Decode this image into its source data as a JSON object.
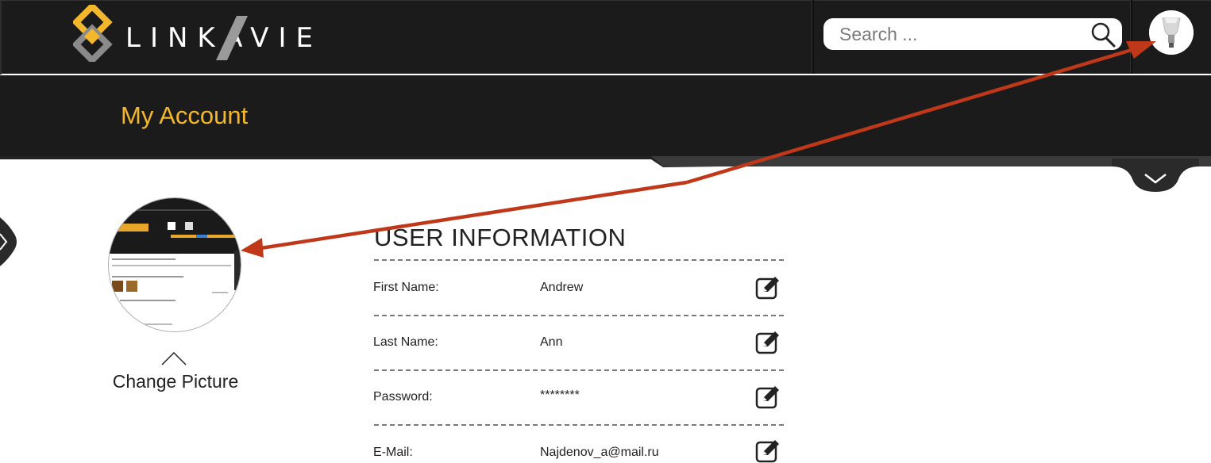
{
  "header": {
    "logo_text": "LINKAVIE",
    "search": {
      "placeholder": "Search ...",
      "value": ""
    },
    "icons": {
      "search": "search-icon",
      "avatar": "lightbulb-avatar-icon"
    }
  },
  "subheader": {
    "title": "My Account"
  },
  "profile": {
    "change_picture_label": "Change Picture"
  },
  "user_info": {
    "title": "USER INFORMATION",
    "rows": [
      {
        "label": "First Name:",
        "value": "Andrew"
      },
      {
        "label": "Last Name:",
        "value": "Ann"
      },
      {
        "label": "Password:",
        "value": "********"
      },
      {
        "label": "E-Mail:",
        "value": "Najdenov_a@mail.ru"
      }
    ]
  },
  "colors": {
    "header_bg": "#1b1b1b",
    "accent": "#f3b72b",
    "annotation_arrow": "#c0381a"
  }
}
